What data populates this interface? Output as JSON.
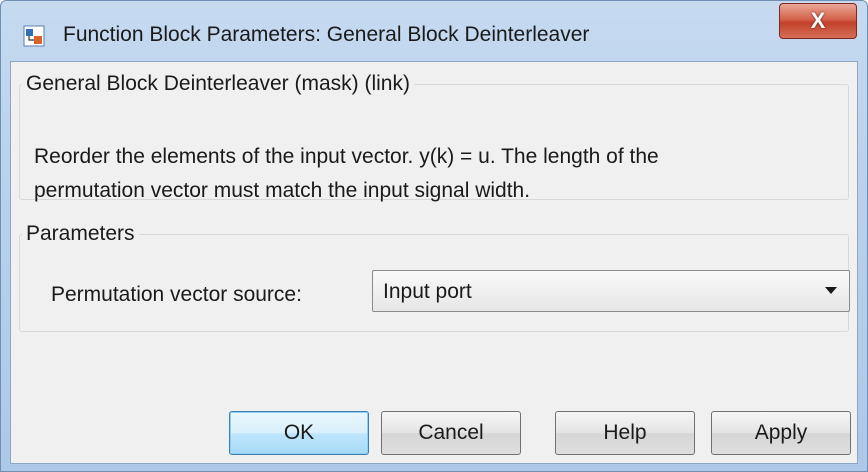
{
  "window": {
    "title": "Function Block Parameters: General Block Deinterleaver",
    "close_glyph": "X"
  },
  "mask_group": {
    "title": "General Block Deinterleaver (mask) (link)",
    "description_line1": "Reorder the elements of the input vector. y(k) = u.  The length of the",
    "description_line2": "permutation vector must match the input signal width."
  },
  "parameters_group": {
    "title": "Parameters",
    "permutation_source_label": "Permutation vector source:",
    "permutation_source_value": "Input port"
  },
  "buttons": {
    "ok": "OK",
    "cancel": "Cancel",
    "help": "Help",
    "apply": "Apply"
  },
  "colors": {
    "default_button_border": "#3c7fb1",
    "close_button": "#c2412a"
  }
}
